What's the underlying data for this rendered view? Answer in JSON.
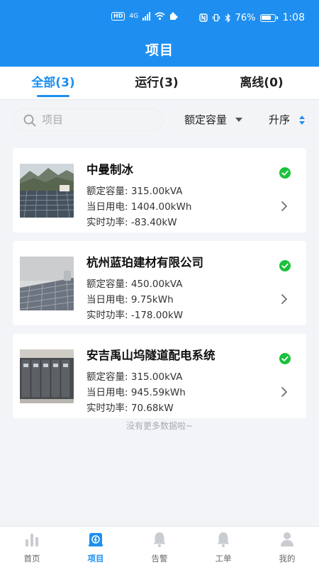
{
  "statusbar": {
    "hd": "HD",
    "network": "4G",
    "battery": "76%",
    "time": "1:08"
  },
  "header": {
    "title": "项目"
  },
  "tabs": [
    {
      "label": "全部(3)",
      "active": true
    },
    {
      "label": "运行(3)",
      "active": false
    },
    {
      "label": "离线(0)",
      "active": false
    }
  ],
  "filters": {
    "search_placeholder": "项目",
    "capacity_label": "额定容量",
    "sort_label": "升序"
  },
  "projects": [
    {
      "name": "中曼制冰",
      "capacity_label": "额定容量:",
      "capacity": "315.00kVA",
      "energy_label": "当日用电:",
      "energy": "1404.00kWh",
      "power_label": "实时功率:",
      "power": "-83.40kW",
      "status": "online",
      "thumb": "solar-field-mountain"
    },
    {
      "name": "杭州蓝珀建材有限公司",
      "capacity_label": "额定容量:",
      "capacity": "450.00kVA",
      "energy_label": "当日用电:",
      "energy": "9.75kWh",
      "power_label": "实时功率:",
      "power": "-178.00kW",
      "status": "online",
      "thumb": "rooftop-solar"
    },
    {
      "name": "安吉禹山坞隧道配电系统",
      "capacity_label": "额定容量:",
      "capacity": "315.00kVA",
      "energy_label": "当日用电:",
      "energy": "945.59kWh",
      "power_label": "实时功率:",
      "power": "70.68kW",
      "status": "online",
      "thumb": "switchgear-room"
    }
  ],
  "list_footer": "没有更多数据啦~",
  "bottom_nav": [
    {
      "label": "首页",
      "icon": "bar-chart-icon",
      "active": false
    },
    {
      "label": "项目",
      "icon": "project-icon",
      "active": true
    },
    {
      "label": "告警",
      "icon": "bell-icon",
      "active": false
    },
    {
      "label": "工单",
      "icon": "bell-icon",
      "active": false
    },
    {
      "label": "我的",
      "icon": "person-icon",
      "active": false
    }
  ],
  "colors": {
    "primary": "#1e8ff0",
    "status_online": "#19c23a",
    "background": "#f2f4f7"
  }
}
